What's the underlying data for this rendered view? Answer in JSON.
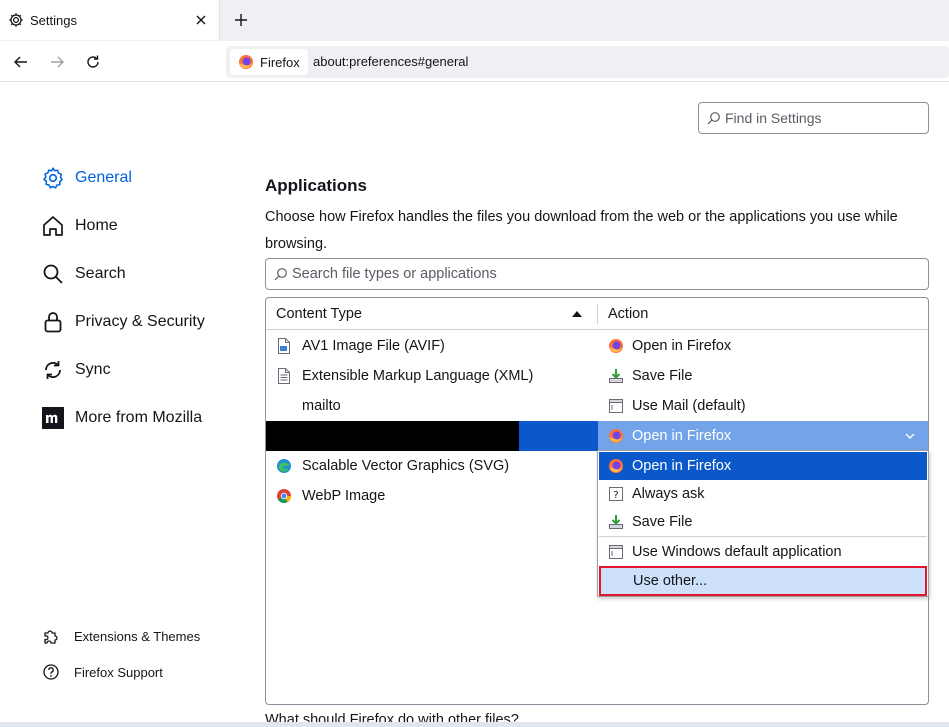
{
  "browser": {
    "tab_title": "Settings",
    "identity_label": "Firefox",
    "url": "about:preferences#general"
  },
  "find": {
    "placeholder": "Find in Settings"
  },
  "sidebar": {
    "categories": [
      {
        "label": "General",
        "icon": "gear-icon",
        "selected": true
      },
      {
        "label": "Home",
        "icon": "home-icon"
      },
      {
        "label": "Search",
        "icon": "search-icon"
      },
      {
        "label": "Privacy & Security",
        "icon": "lock-icon"
      },
      {
        "label": "Sync",
        "icon": "sync-icon"
      },
      {
        "label": "More from Mozilla",
        "icon": "mozilla-icon"
      }
    ],
    "footer": [
      {
        "label": "Extensions & Themes",
        "icon": "puzzle-icon"
      },
      {
        "label": "Firefox Support",
        "icon": "help-icon"
      }
    ]
  },
  "applications": {
    "title": "Applications",
    "description": "Choose how Firefox handles the files you download from the web or the applications you use while browsing.",
    "search_placeholder": "Search file types or applications",
    "columns": {
      "type": "Content Type",
      "action": "Action"
    },
    "rows": [
      {
        "type": "AV1 Image File (AVIF)",
        "type_icon": "image-file-icon",
        "action": "Open in Firefox",
        "action_icon": "firefox-icon"
      },
      {
        "type": "Extensible Markup Language (XML)",
        "type_icon": "document-file-icon",
        "action": "Save File",
        "action_icon": "save-file-icon"
      },
      {
        "type": "mailto",
        "type_icon": "",
        "action": "Use Mail (default)",
        "action_icon": "app-window-icon"
      },
      {
        "type": "",
        "type_icon": "",
        "action": "Open in Firefox",
        "action_icon": "firefox-icon",
        "selected": true
      },
      {
        "type": "Scalable Vector Graphics (SVG)",
        "type_icon": "edge-icon",
        "action": "",
        "action_icon": ""
      },
      {
        "type": "WebP Image",
        "type_icon": "chrome-icon",
        "action": "",
        "action_icon": ""
      }
    ],
    "dropdown_options": [
      {
        "label": "Open in Firefox",
        "icon": "firefox-icon",
        "state": "active"
      },
      {
        "label": "Always ask",
        "icon": "ask-icon"
      },
      {
        "label": "Save File",
        "icon": "save-file-icon"
      },
      {
        "label": "Use Windows default application",
        "icon": "app-window-icon"
      },
      {
        "label": "Use other...",
        "icon": "",
        "state": "hover"
      }
    ],
    "other_files_question": "What should Firefox do with other files?"
  },
  "colors": {
    "accent": "#0061e0",
    "selected_row": "#0a58ca",
    "select_bg": "#73a3e8",
    "highlight_border": "#e0142c"
  }
}
